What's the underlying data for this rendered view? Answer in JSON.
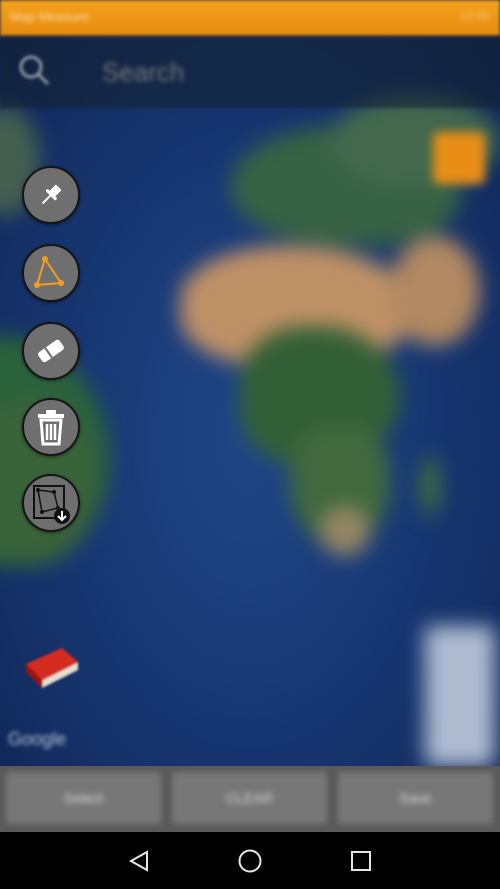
{
  "status_bar": {
    "left_text": "Map Measure",
    "right_text": "12:00"
  },
  "search": {
    "placeholder": "Search",
    "icon": "search-icon"
  },
  "tools": [
    {
      "name": "pin-tool",
      "icon": "pin-icon"
    },
    {
      "name": "polygon-tool",
      "icon": "polygon-icon"
    },
    {
      "name": "eraser-tool",
      "icon": "eraser-icon"
    },
    {
      "name": "delete-tool",
      "icon": "trash-icon"
    },
    {
      "name": "save-shape-tool",
      "icon": "polygon-download-icon"
    }
  ],
  "map": {
    "attribution": "Google"
  },
  "bottom_bar": {
    "buttons": [
      "Select",
      "CLEAR",
      "Save"
    ]
  },
  "colors": {
    "accent": "#e88e17",
    "tool_bg": "#6f6f6f",
    "polygon_vertex": "#f0a020"
  }
}
